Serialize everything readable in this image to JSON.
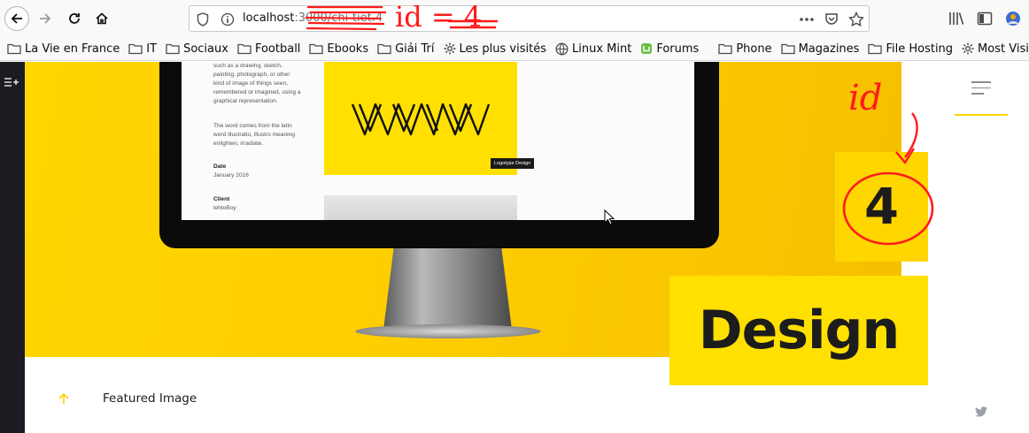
{
  "browser": {
    "url_host": "localhost",
    "url_path": ":3000/chi-tiet.4",
    "bookmarks": [
      {
        "label": "La Vie en France",
        "icon": "folder-icon"
      },
      {
        "label": "IT",
        "icon": "folder-icon"
      },
      {
        "label": "Sociaux",
        "icon": "folder-icon"
      },
      {
        "label": "Football",
        "icon": "folder-icon"
      },
      {
        "label": "Ebooks",
        "icon": "folder-icon"
      },
      {
        "label": "Giải Trí",
        "icon": "folder-icon"
      },
      {
        "label": "Les plus visités",
        "icon": "gear-icon"
      },
      {
        "label": "Linux Mint",
        "icon": "globe-icon"
      },
      {
        "label": "Forums",
        "icon": "mint-icon"
      },
      {
        "label": "Phone",
        "icon": "folder-icon"
      },
      {
        "label": "Magazines",
        "icon": "folder-icon"
      },
      {
        "label": "File Hosting",
        "icon": "folder-icon"
      },
      {
        "label": "Most Visited",
        "icon": "gear-icon"
      }
    ]
  },
  "hero": {
    "screen_text_1": "such as a drawing, sketch, painting, photograph, or other kind of image of things seen, remembered or imagined, using a graphical representation.",
    "screen_text_2": "The word comes from the latin word illustratio, illustro meaning enlighten, irradiate.",
    "screen_date_title": "Date",
    "screen_date_value": "January 2016",
    "screen_client_title": "Client",
    "screen_client_value": "lehtoBoy",
    "screen_badge": "Logotype Design",
    "id_number": "4",
    "category": "Design"
  },
  "content": {
    "featured_label": "Featured Image"
  },
  "annotations": {
    "url_note": "id = 4",
    "arrow_note": "id"
  },
  "colors": {
    "accent": "#ffd600",
    "annotation": "#ff1b1b"
  }
}
